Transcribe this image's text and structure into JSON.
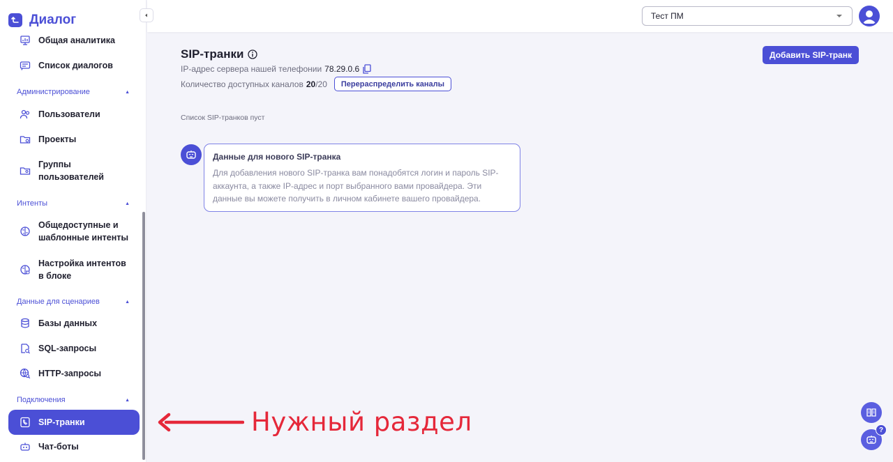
{
  "app": {
    "title": "Диалог"
  },
  "sidebar": {
    "items": [
      {
        "label": "Общая аналитика",
        "icon": "analytics-icon"
      },
      {
        "label": "Список диалогов",
        "icon": "dialogs-list-icon"
      },
      {
        "label": "Пользователи",
        "icon": "users-icon"
      },
      {
        "label": "Проекты",
        "icon": "projects-icon"
      },
      {
        "label": "Группы пользователей",
        "icon": "user-groups-icon"
      },
      {
        "label": "Общедоступные и шаблонные интенты",
        "icon": "brain-icon"
      },
      {
        "label": "Настройка интентов в блоке",
        "icon": "brain-settings-icon"
      },
      {
        "label": "Базы данных",
        "icon": "database-icon"
      },
      {
        "label": "SQL-запросы",
        "icon": "sql-query-icon"
      },
      {
        "label": "HTTP-запросы",
        "icon": "http-query-icon"
      },
      {
        "label": "SIP-транки",
        "icon": "sip-trunk-icon"
      },
      {
        "label": "Чат-боты",
        "icon": "chatbot-icon"
      }
    ],
    "sections": [
      {
        "label": "Администрирование"
      },
      {
        "label": "Интенты"
      },
      {
        "label": "Данные для сценариев"
      },
      {
        "label": "Подключения"
      }
    ],
    "active_item": "SIP-транки"
  },
  "header": {
    "project_select": {
      "value": "Тест ПМ"
    }
  },
  "main": {
    "title": "SIP-транки",
    "ip_label": "IP-адрес сервера нашей телефонии",
    "ip_value": "78.29.0.6",
    "channels_label": "Количество доступных каналов",
    "channels_available": "20",
    "channels_total": "/20",
    "redistribute_label": "Перераспределить каналы",
    "add_label": "Добавить SIP-транк",
    "empty_text": "Список SIP-транков пуст",
    "tip": {
      "title": "Данные для нового SIP-транка",
      "body": "Для добавления нового SIP-транка вам понадобятся логин и пароль SIP-аккаунта, а также IP-адрес и порт выбранного вами провайдера. Эти данные вы можете получить в личном кабинете вашего провайдера."
    }
  },
  "annotation": {
    "text": "Нужный раздел"
  },
  "floating": {
    "help_badge": "?"
  },
  "colors": {
    "accent": "#4b4fd6",
    "annotation": "#e5283a",
    "background": "#f4f4fa"
  }
}
